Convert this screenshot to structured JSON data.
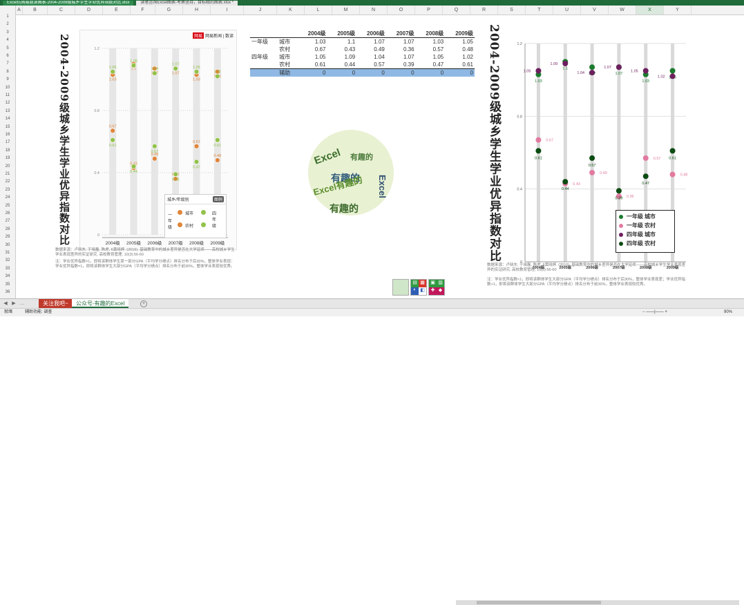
{
  "tabs": [
    {
      "label": "Excel仿网易数读图表-2004-2009级城乡学生学业优异指数对比.xlsx"
    },
    {
      "label": "读者咨询Excel图表-考察坚持，目标精的图表.xlsx *"
    }
  ],
  "columns": [
    "A",
    "B",
    "C",
    "D",
    "E",
    "F",
    "G",
    "H",
    "I",
    "J",
    "K",
    "L",
    "M",
    "N",
    "O",
    "P",
    "Q",
    "R",
    "S",
    "T",
    "U",
    "V",
    "W",
    "X",
    "Y"
  ],
  "selected_column": "X",
  "rows": [
    "1",
    "2",
    "3",
    "4",
    "5",
    "6",
    "7",
    "8",
    "9",
    "10",
    "11",
    "12",
    "13",
    "14",
    "15",
    "16",
    "17",
    "18",
    "19",
    "20",
    "21",
    "22",
    "23",
    "24",
    "25",
    "26",
    "27",
    "28",
    "29",
    "30",
    "31",
    "32",
    "33",
    "34",
    "35",
    "36"
  ],
  "title": "2004-2009级城乡学生学业优异指数对比",
  "brand": {
    "badge": "网易",
    "name": "网易新闻 | 数读"
  },
  "table": {
    "headers": [
      "",
      "",
      "2004级",
      "2005级",
      "2006级",
      "2007级",
      "2008级",
      "2009级"
    ],
    "rows": [
      {
        "group": "一年级",
        "area": "城市",
        "v": [
          "1.03",
          "1.1",
          "1.07",
          "1.07",
          "1.03",
          "1.05"
        ]
      },
      {
        "group": "",
        "area": "农村",
        "v": [
          "0.67",
          "0.43",
          "0.49",
          "0.36",
          "0.57",
          "0.48"
        ]
      },
      {
        "group": "四年级",
        "area": "城市",
        "v": [
          "1.05",
          "1.09",
          "1.04",
          "1.07",
          "1.05",
          "1.02"
        ]
      },
      {
        "group": "",
        "area": "农村",
        "v": [
          "0.61",
          "0.44",
          "0.57",
          "0.39",
          "0.47",
          "0.61"
        ]
      },
      {
        "group": "",
        "area": "辅助",
        "v": [
          "0",
          "0",
          "0",
          "0",
          "0",
          "0"
        ]
      }
    ]
  },
  "legend_left": {
    "title": "城乡/年级别",
    "badge": "图例",
    "g1": "一年级",
    "g2": "四年级",
    "city": "城市",
    "rural": "农村"
  },
  "legend_right": [
    "一年级 城市",
    "一年级 农村",
    "四年级 城市",
    "四年级 农村"
  ],
  "source_left": "数据来源：卢晓东, 于晓磊, 陈虎, 6黄晓婷. (2016). 基础教育中的城乡差异是否在大学延续——高校城乡学生学业表现差异的实证研究. 高校教育管理, 10(3):56-60",
  "note_left": "注：学业优异指数=1，即将该群体学生某一部分GPA（平均学分绩点）排名分布于后30%，整体学业表现：学业优异指数=1，即将该群体学生大部分GPA（平均学分绩点）排名分布于前30%，整体学业表现较优秀。",
  "source_right": "数据来源：卢晓东, 于晓磊, 陈虎, 6黄晓婷. (2016). 基础教育中的城乡差异是否在大学延续——高校城乡学生学业表现差异的实证研究. 高校教育管理, 10(3):56-60",
  "note_right": "注：学业优异指数<1，即将该群体学生大部分GPA（平均学分绩点）排名分布于后30%，整体学业表现差；学业优异指数>1，即将该群体学生大部分GPA（平均学分绩点）排名分布于前30%，整体学业表现较优秀。",
  "wordcloud": {
    "words": [
      "Excel",
      "有趣的",
      "Excel有趣的",
      "有趣的",
      "Excel",
      "有趣的"
    ]
  },
  "sheet_tabs": [
    "关注我吧~",
    "公众号-有趣的Excel"
  ],
  "status": {
    "left": "就绪",
    "mode": "辅助功能: 调查",
    "zoom": "90%"
  },
  "colors": {
    "city1": "#1b7a2e",
    "rural1": "#e27aa0",
    "city4": "#6d1f5e",
    "rural4": "#0c4b12",
    "left_city": "#92c24a",
    "left_rural": "#e0853a"
  },
  "chart_data": [
    {
      "type": "scatter",
      "categories": [
        "2004级",
        "2005级",
        "2006级",
        "2007级",
        "2008级",
        "2009级"
      ],
      "ylim": [
        0,
        1.2
      ],
      "yticks": [
        "0",
        "0.4",
        "0.8",
        "1.2"
      ],
      "series": [
        {
          "name": "一年级 城市",
          "values": [
            1.03,
            1.1,
            1.07,
            1.07,
            1.03,
            1.05
          ]
        },
        {
          "name": "一年级 农村",
          "values": [
            0.67,
            0.43,
            0.49,
            0.36,
            0.57,
            0.48
          ]
        },
        {
          "name": "四年级 城市",
          "values": [
            1.05,
            1.09,
            1.04,
            1.07,
            1.05,
            1.02
          ]
        },
        {
          "name": "四年级 农村",
          "values": [
            0.61,
            0.44,
            0.57,
            0.39,
            0.47,
            0.61
          ]
        }
      ]
    },
    {
      "type": "scatter",
      "categories": [
        "2004级",
        "2005级",
        "2006级",
        "2007级",
        "2008级",
        "2009级"
      ],
      "ylim": [
        0,
        1.2
      ],
      "yticks": [
        "0",
        "0.4",
        "0.8",
        "1.2"
      ],
      "series": [
        {
          "name": "一年级 城市",
          "values": [
            1.03,
            1.1,
            1.07,
            1.07,
            1.03,
            1.05
          ]
        },
        {
          "name": "一年级 农村",
          "values": [
            0.67,
            0.43,
            0.49,
            0.36,
            0.57,
            0.48
          ]
        },
        {
          "name": "四年级 城市",
          "values": [
            1.05,
            1.09,
            1.04,
            1.07,
            1.05,
            1.02
          ]
        },
        {
          "name": "四年级 农村",
          "values": [
            0.61,
            0.44,
            0.57,
            0.39,
            0.47,
            0.61
          ]
        }
      ]
    }
  ]
}
